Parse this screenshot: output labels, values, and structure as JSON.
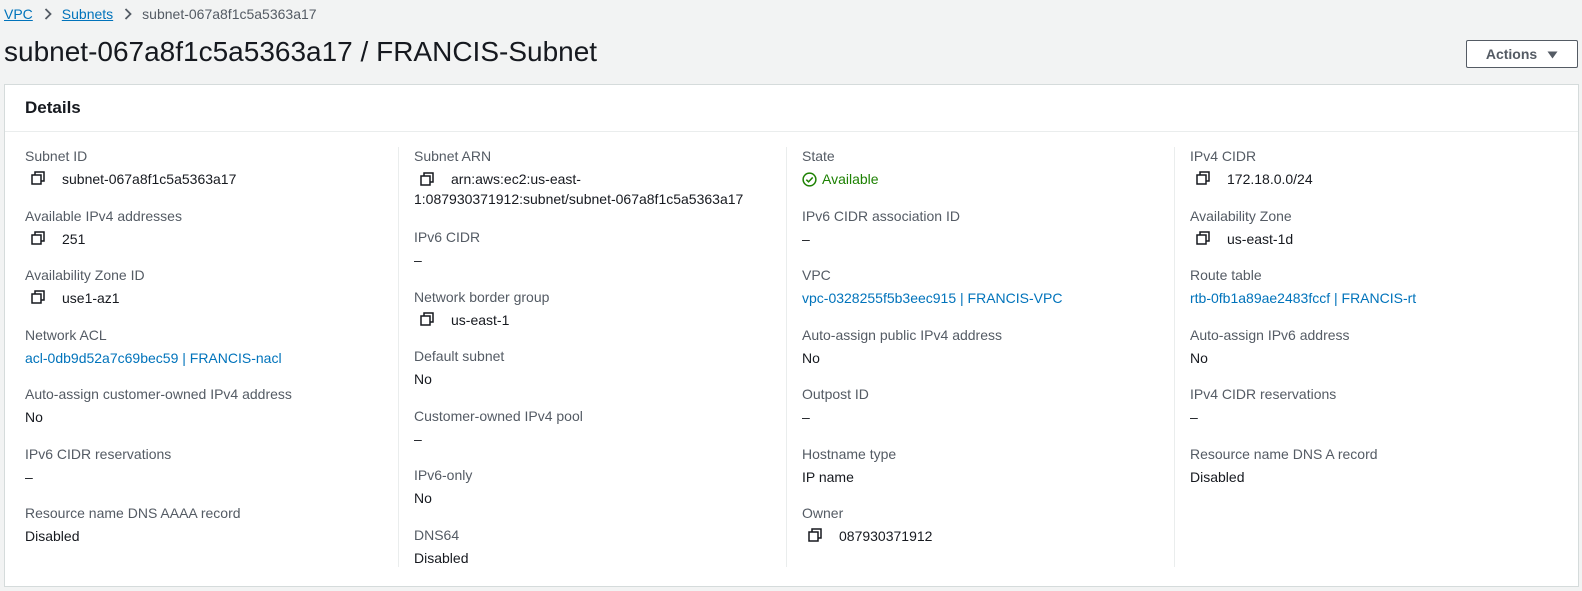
{
  "breadcrumb": {
    "items": [
      "VPC",
      "Subnets"
    ],
    "current": "subnet-067a8f1c5a5363a17"
  },
  "header": {
    "title": "subnet-067a8f1c5a5363a17 / FRANCIS-Subnet",
    "actions_label": "Actions"
  },
  "details": {
    "title": "Details",
    "col1": {
      "subnet_id_label": "Subnet ID",
      "subnet_id": "subnet-067a8f1c5a5363a17",
      "available_ipv4_label": "Available IPv4 addresses",
      "available_ipv4": "251",
      "az_id_label": "Availability Zone ID",
      "az_id": "use1-az1",
      "network_acl_label": "Network ACL",
      "network_acl": "acl-0db9d52a7c69bec59 | FRANCIS-nacl",
      "auto_customer_ipv4_label": "Auto-assign customer-owned IPv4 address",
      "auto_customer_ipv4": "No",
      "ipv6_cidr_reservations_label": "IPv6 CIDR reservations",
      "ipv6_cidr_reservations": "–",
      "dns_aaaa_label": "Resource name DNS AAAA record",
      "dns_aaaa": "Disabled"
    },
    "col2": {
      "subnet_arn_label": "Subnet ARN",
      "subnet_arn_line1": "arn:aws:ec2:us-east-",
      "subnet_arn_line2": "1:087930371912:subnet/subnet-067a8f1c5a5363a17",
      "ipv6_cidr_label": "IPv6 CIDR",
      "ipv6_cidr": "–",
      "network_border_group_label": "Network border group",
      "network_border_group": "us-east-1",
      "default_subnet_label": "Default subnet",
      "default_subnet": "No",
      "customer_ipv4_pool_label": "Customer-owned IPv4 pool",
      "customer_ipv4_pool": "–",
      "ipv6_only_label": "IPv6-only",
      "ipv6_only": "No",
      "dns64_label": "DNS64",
      "dns64": "Disabled"
    },
    "col3": {
      "state_label": "State",
      "state": "Available",
      "ipv6_assoc_label": "IPv6 CIDR association ID",
      "ipv6_assoc": "–",
      "vpc_label": "VPC",
      "vpc": "vpc-0328255f5b3eec915 | FRANCIS-VPC",
      "auto_public_ipv4_label": "Auto-assign public IPv4 address",
      "auto_public_ipv4": "No",
      "outpost_id_label": "Outpost ID",
      "outpost_id": "–",
      "hostname_type_label": "Hostname type",
      "hostname_type": "IP name",
      "owner_label": "Owner",
      "owner": "087930371912"
    },
    "col4": {
      "ipv4_cidr_label": "IPv4 CIDR",
      "ipv4_cidr": "172.18.0.0/24",
      "az_label": "Availability Zone",
      "az": "us-east-1d",
      "route_table_label": "Route table",
      "route_table": "rtb-0fb1a89ae2483fccf | FRANCIS-rt",
      "auto_ipv6_label": "Auto-assign IPv6 address",
      "auto_ipv6": "No",
      "ipv4_cidr_reservations_label": "IPv4 CIDR reservations",
      "ipv4_cidr_reservations": "–",
      "dns_a_label": "Resource name DNS A record",
      "dns_a": "Disabled"
    }
  },
  "colors": {
    "link": "#0073bb",
    "success": "#1d8102",
    "label": "#545b64",
    "text": "#16191f"
  }
}
